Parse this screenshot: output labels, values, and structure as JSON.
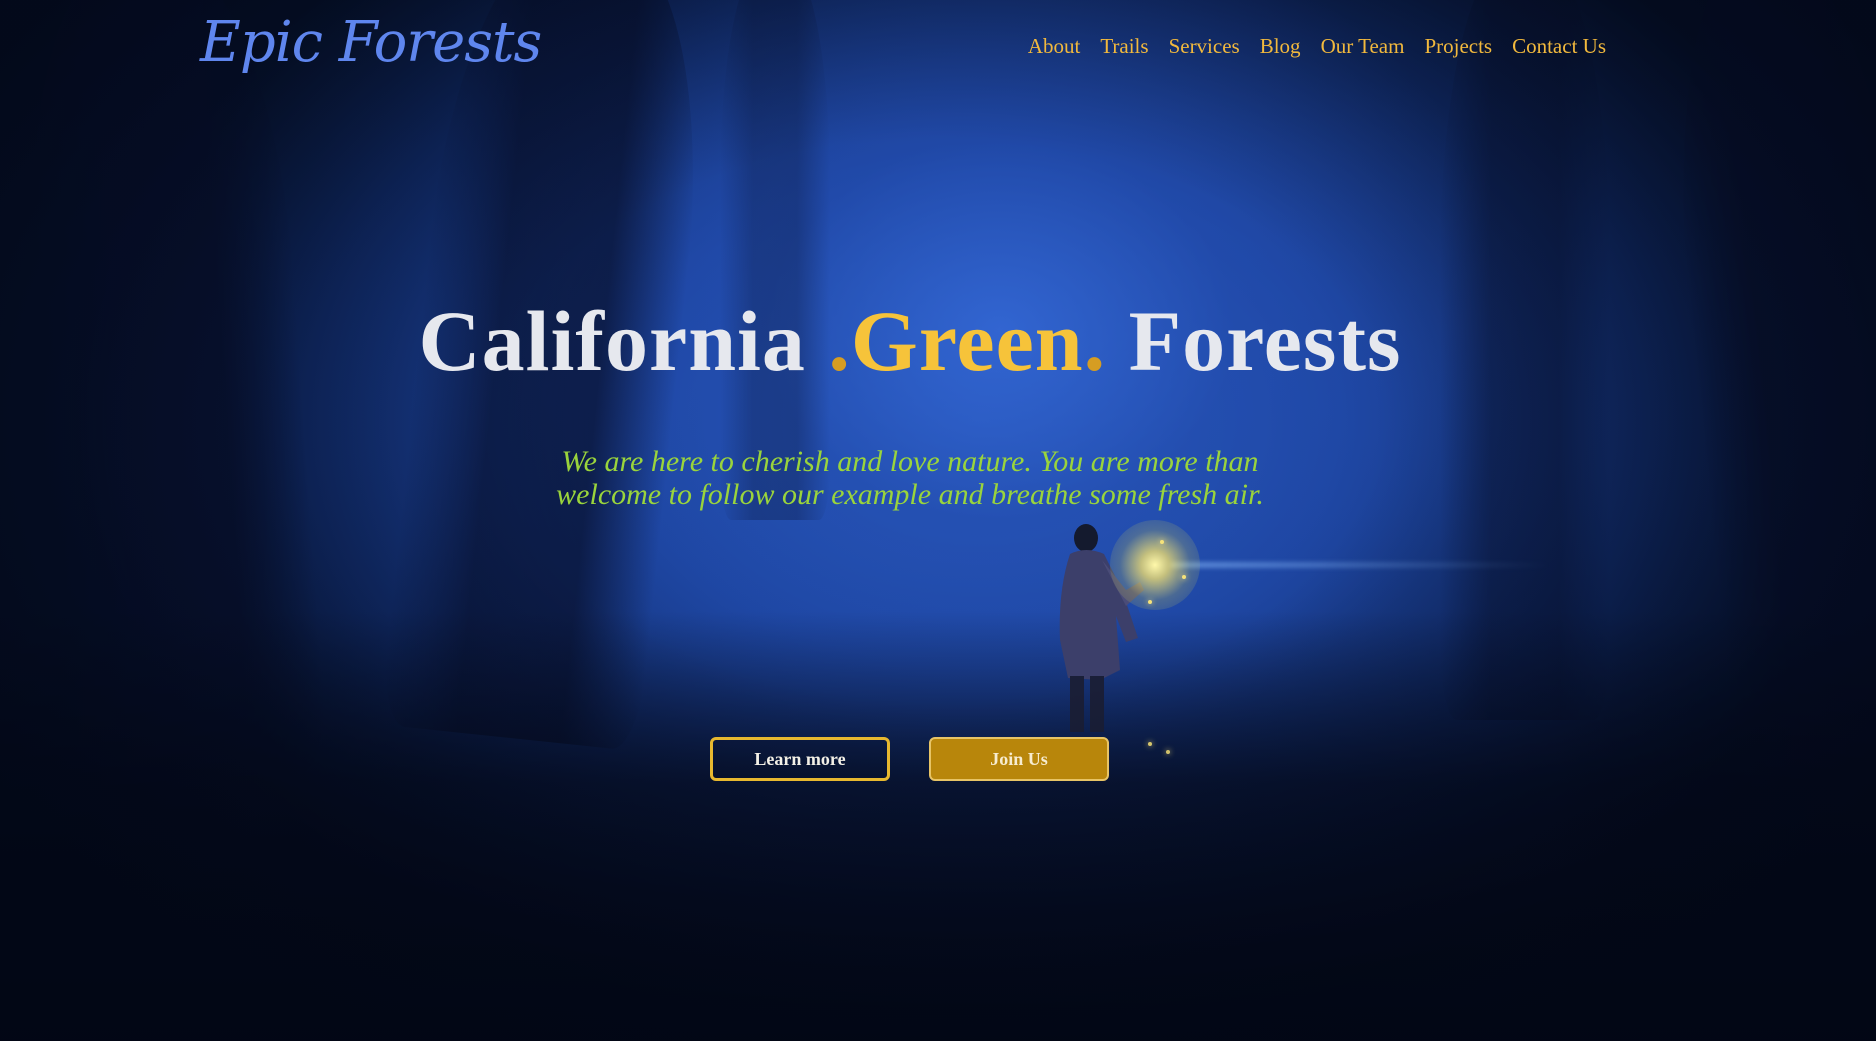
{
  "brand": {
    "logo_text": "Epic Forests"
  },
  "nav": {
    "items": [
      {
        "label": "About"
      },
      {
        "label": "Trails"
      },
      {
        "label": "Services"
      },
      {
        "label": "Blog"
      },
      {
        "label": "Our Team"
      },
      {
        "label": "Projects"
      },
      {
        "label": "Contact Us"
      }
    ]
  },
  "hero": {
    "title_part1": "California ",
    "title_dot_left": ".",
    "title_accent": "Green",
    "title_dot_right": ".",
    "title_part2": " Forests",
    "tagline_line1": "We are here to cherish and love nature. You are more than",
    "tagline_line2": "welcome to follow our example and breathe some fresh air.",
    "primary_button": "Learn more",
    "secondary_button": "Join Us"
  },
  "colors": {
    "logo": "#5f86ee",
    "nav_link": "#f2b93d",
    "title": "#e6e8ee",
    "title_accent": "#f6c33a",
    "tagline": "#9ad43c",
    "button_border": "#e7b82f",
    "button_fill": "#b8860b",
    "background": "#1d45a0"
  },
  "icons": {
    "background_scene": "forest-lantern-figure-illustration"
  }
}
